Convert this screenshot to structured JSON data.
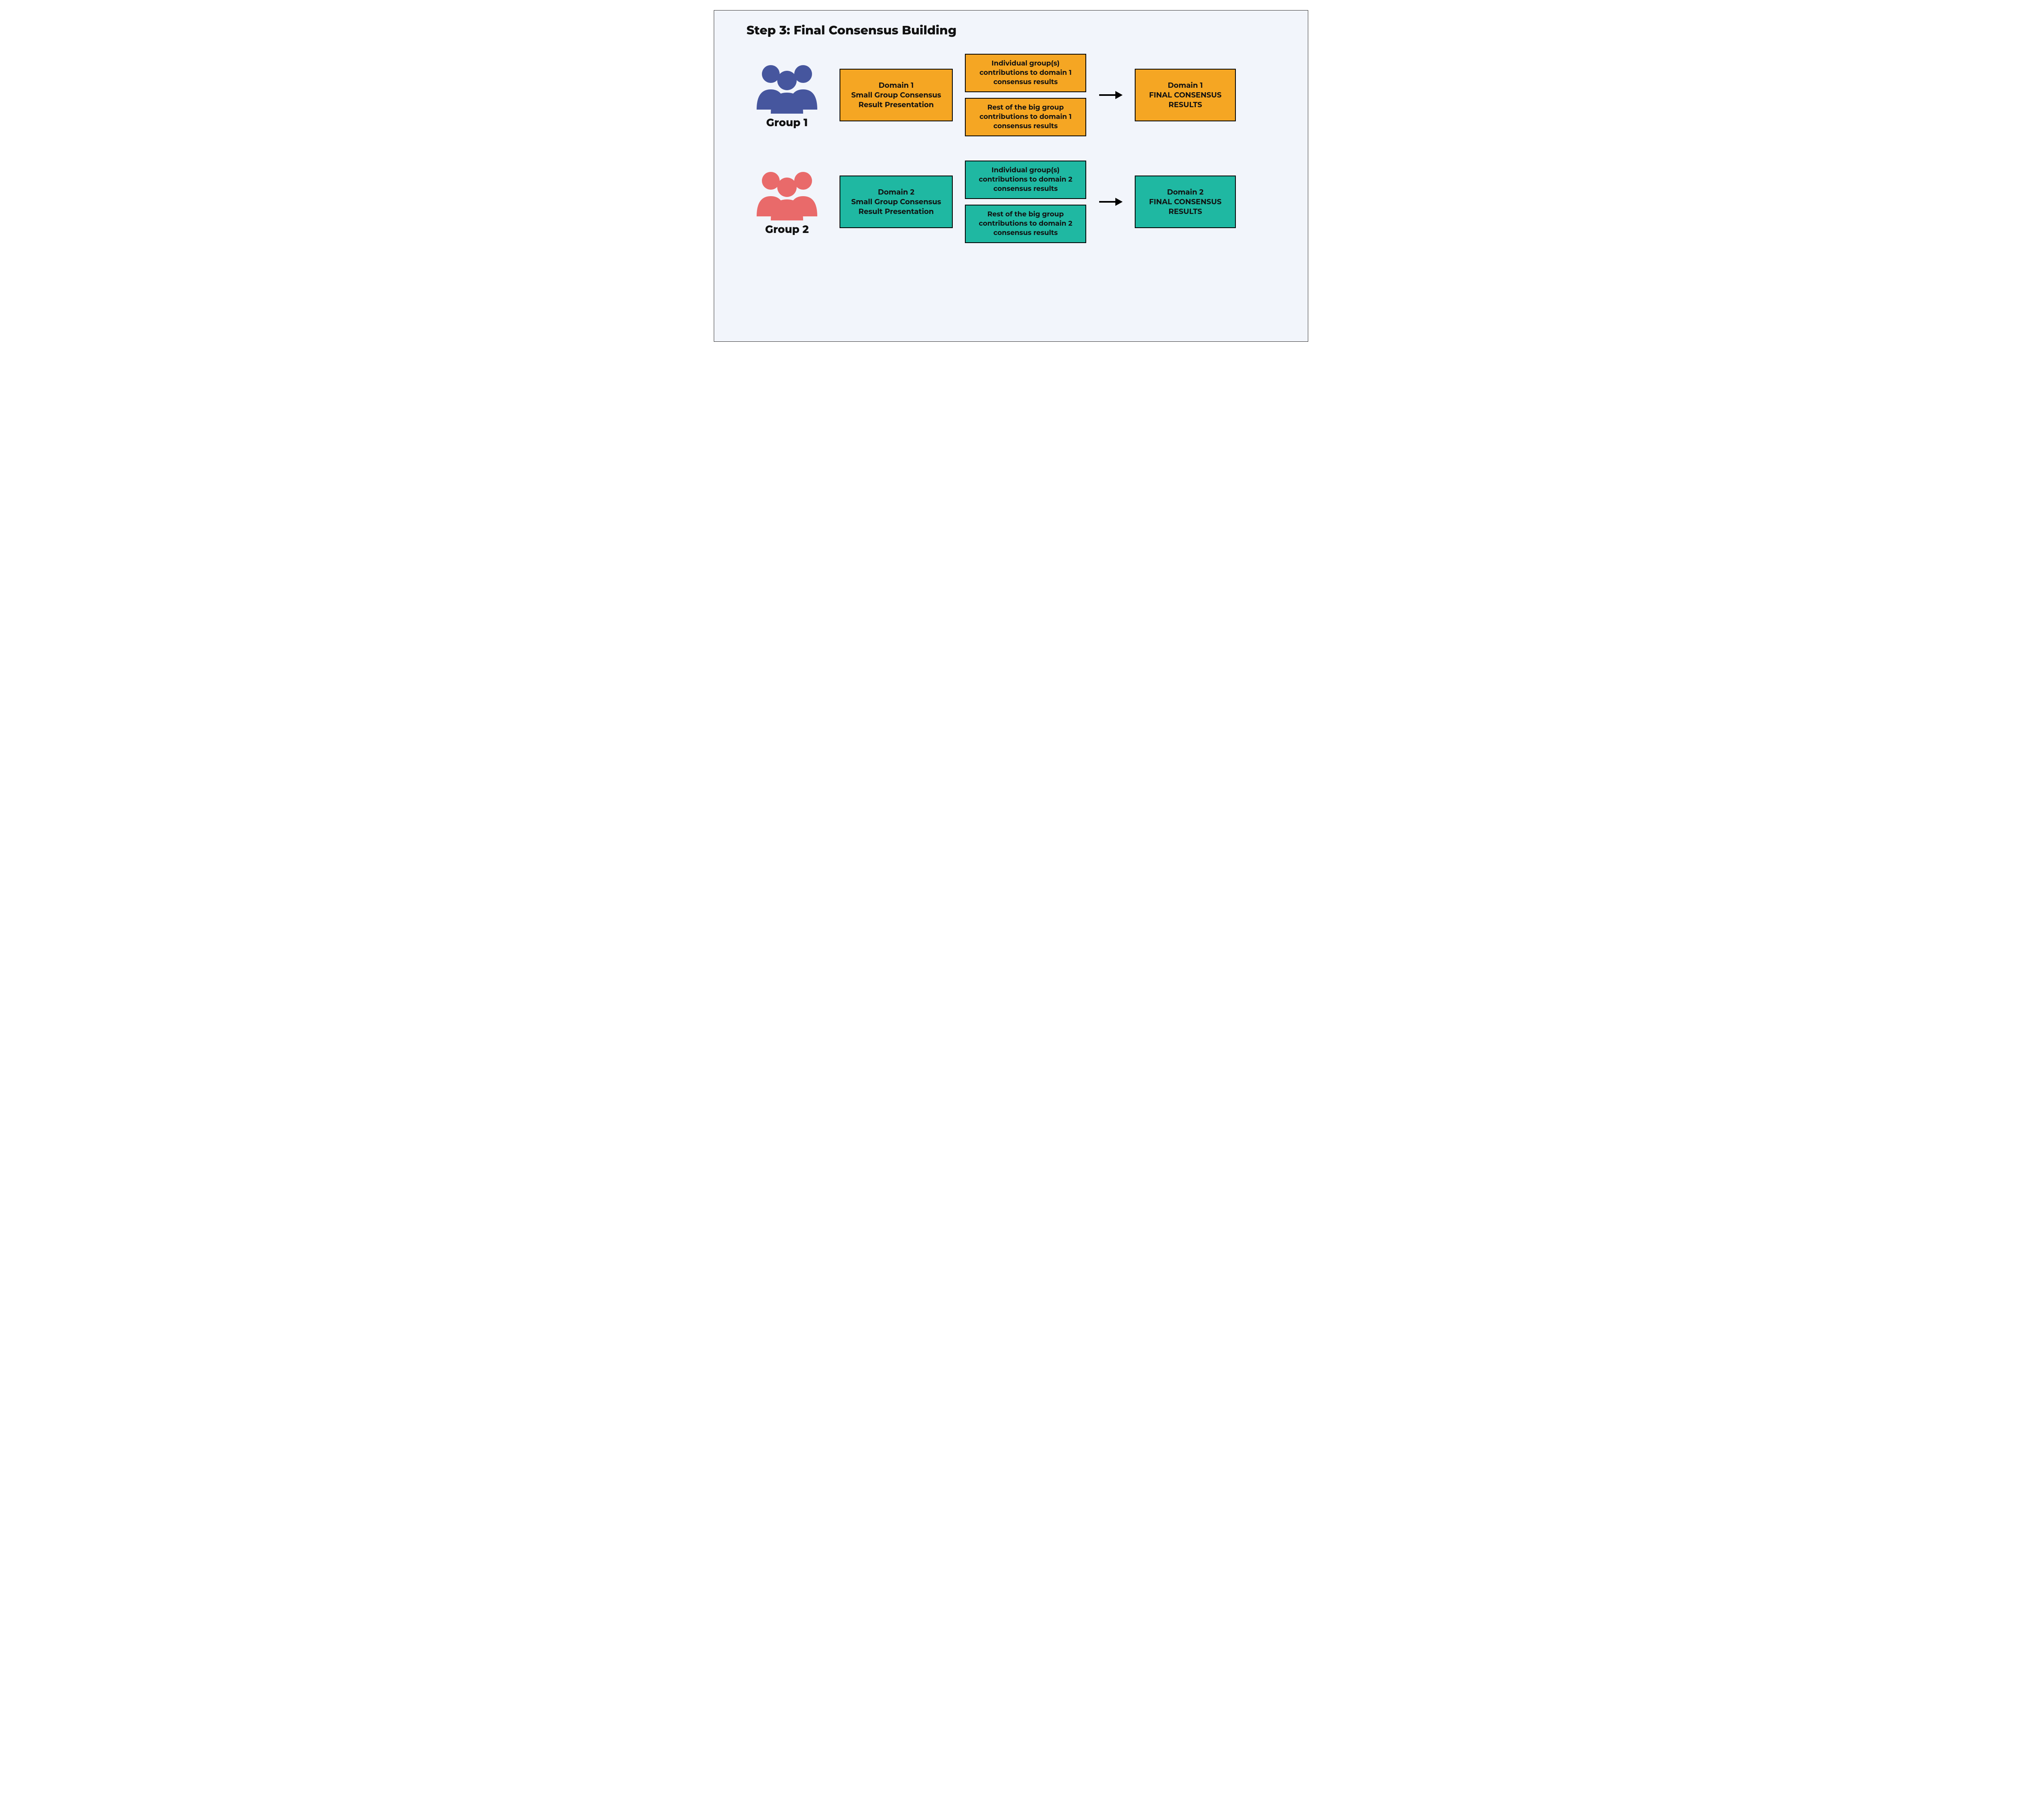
{
  "title": "Step 3: Final Consensus Building",
  "colors": {
    "frame_bg": "#f2f5fb",
    "orange": "#f5a623",
    "teal": "#1fb8a2",
    "group1_people": "#46569e",
    "group2_people": "#e96a6a"
  },
  "groups": [
    {
      "id": "group1",
      "label": "Group 1",
      "people_color": "#46569e",
      "box_color": "orange",
      "main_box": "Domain 1\nSmall Group Consensus\nResult Presentation",
      "contrib_individual": "Individual group(s)\ncontributions to domain 1\nconsensus results",
      "contrib_rest": "Rest of the big group\ncontributions to domain 1\nconsensus results",
      "final_box": "Domain 1\nFINAL CONSENSUS\nRESULTS"
    },
    {
      "id": "group2",
      "label": "Group 2",
      "people_color": "#e96a6a",
      "box_color": "teal",
      "main_box": "Domain 2\nSmall Group Consensus\nResult Presentation",
      "contrib_individual": "Individual group(s)\ncontributions to domain 2\nconsensus results",
      "contrib_rest": "Rest of the big group\ncontributions to domain 2\nconsensus results",
      "final_box": "Domain 2\nFINAL CONSENSUS\nRESULTS"
    }
  ]
}
